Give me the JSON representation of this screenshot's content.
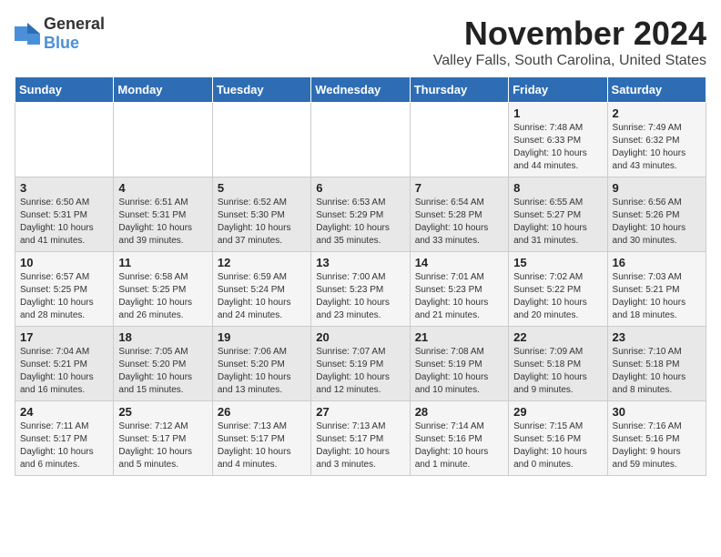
{
  "logo": {
    "general": "General",
    "blue": "Blue"
  },
  "title": "November 2024",
  "location": "Valley Falls, South Carolina, United States",
  "weekdays": [
    "Sunday",
    "Monday",
    "Tuesday",
    "Wednesday",
    "Thursday",
    "Friday",
    "Saturday"
  ],
  "weeks": [
    [
      {
        "day": "",
        "info": ""
      },
      {
        "day": "",
        "info": ""
      },
      {
        "day": "",
        "info": ""
      },
      {
        "day": "",
        "info": ""
      },
      {
        "day": "",
        "info": ""
      },
      {
        "day": "1",
        "info": "Sunrise: 7:48 AM\nSunset: 6:33 PM\nDaylight: 10 hours\nand 44 minutes."
      },
      {
        "day": "2",
        "info": "Sunrise: 7:49 AM\nSunset: 6:32 PM\nDaylight: 10 hours\nand 43 minutes."
      }
    ],
    [
      {
        "day": "3",
        "info": "Sunrise: 6:50 AM\nSunset: 5:31 PM\nDaylight: 10 hours\nand 41 minutes."
      },
      {
        "day": "4",
        "info": "Sunrise: 6:51 AM\nSunset: 5:31 PM\nDaylight: 10 hours\nand 39 minutes."
      },
      {
        "day": "5",
        "info": "Sunrise: 6:52 AM\nSunset: 5:30 PM\nDaylight: 10 hours\nand 37 minutes."
      },
      {
        "day": "6",
        "info": "Sunrise: 6:53 AM\nSunset: 5:29 PM\nDaylight: 10 hours\nand 35 minutes."
      },
      {
        "day": "7",
        "info": "Sunrise: 6:54 AM\nSunset: 5:28 PM\nDaylight: 10 hours\nand 33 minutes."
      },
      {
        "day": "8",
        "info": "Sunrise: 6:55 AM\nSunset: 5:27 PM\nDaylight: 10 hours\nand 31 minutes."
      },
      {
        "day": "9",
        "info": "Sunrise: 6:56 AM\nSunset: 5:26 PM\nDaylight: 10 hours\nand 30 minutes."
      }
    ],
    [
      {
        "day": "10",
        "info": "Sunrise: 6:57 AM\nSunset: 5:25 PM\nDaylight: 10 hours\nand 28 minutes."
      },
      {
        "day": "11",
        "info": "Sunrise: 6:58 AM\nSunset: 5:25 PM\nDaylight: 10 hours\nand 26 minutes."
      },
      {
        "day": "12",
        "info": "Sunrise: 6:59 AM\nSunset: 5:24 PM\nDaylight: 10 hours\nand 24 minutes."
      },
      {
        "day": "13",
        "info": "Sunrise: 7:00 AM\nSunset: 5:23 PM\nDaylight: 10 hours\nand 23 minutes."
      },
      {
        "day": "14",
        "info": "Sunrise: 7:01 AM\nSunset: 5:23 PM\nDaylight: 10 hours\nand 21 minutes."
      },
      {
        "day": "15",
        "info": "Sunrise: 7:02 AM\nSunset: 5:22 PM\nDaylight: 10 hours\nand 20 minutes."
      },
      {
        "day": "16",
        "info": "Sunrise: 7:03 AM\nSunset: 5:21 PM\nDaylight: 10 hours\nand 18 minutes."
      }
    ],
    [
      {
        "day": "17",
        "info": "Sunrise: 7:04 AM\nSunset: 5:21 PM\nDaylight: 10 hours\nand 16 minutes."
      },
      {
        "day": "18",
        "info": "Sunrise: 7:05 AM\nSunset: 5:20 PM\nDaylight: 10 hours\nand 15 minutes."
      },
      {
        "day": "19",
        "info": "Sunrise: 7:06 AM\nSunset: 5:20 PM\nDaylight: 10 hours\nand 13 minutes."
      },
      {
        "day": "20",
        "info": "Sunrise: 7:07 AM\nSunset: 5:19 PM\nDaylight: 10 hours\nand 12 minutes."
      },
      {
        "day": "21",
        "info": "Sunrise: 7:08 AM\nSunset: 5:19 PM\nDaylight: 10 hours\nand 10 minutes."
      },
      {
        "day": "22",
        "info": "Sunrise: 7:09 AM\nSunset: 5:18 PM\nDaylight: 10 hours\nand 9 minutes."
      },
      {
        "day": "23",
        "info": "Sunrise: 7:10 AM\nSunset: 5:18 PM\nDaylight: 10 hours\nand 8 minutes."
      }
    ],
    [
      {
        "day": "24",
        "info": "Sunrise: 7:11 AM\nSunset: 5:17 PM\nDaylight: 10 hours\nand 6 minutes."
      },
      {
        "day": "25",
        "info": "Sunrise: 7:12 AM\nSunset: 5:17 PM\nDaylight: 10 hours\nand 5 minutes."
      },
      {
        "day": "26",
        "info": "Sunrise: 7:13 AM\nSunset: 5:17 PM\nDaylight: 10 hours\nand 4 minutes."
      },
      {
        "day": "27",
        "info": "Sunrise: 7:13 AM\nSunset: 5:17 PM\nDaylight: 10 hours\nand 3 minutes."
      },
      {
        "day": "28",
        "info": "Sunrise: 7:14 AM\nSunset: 5:16 PM\nDaylight: 10 hours\nand 1 minute."
      },
      {
        "day": "29",
        "info": "Sunrise: 7:15 AM\nSunset: 5:16 PM\nDaylight: 10 hours\nand 0 minutes."
      },
      {
        "day": "30",
        "info": "Sunrise: 7:16 AM\nSunset: 5:16 PM\nDaylight: 9 hours\nand 59 minutes."
      }
    ]
  ]
}
